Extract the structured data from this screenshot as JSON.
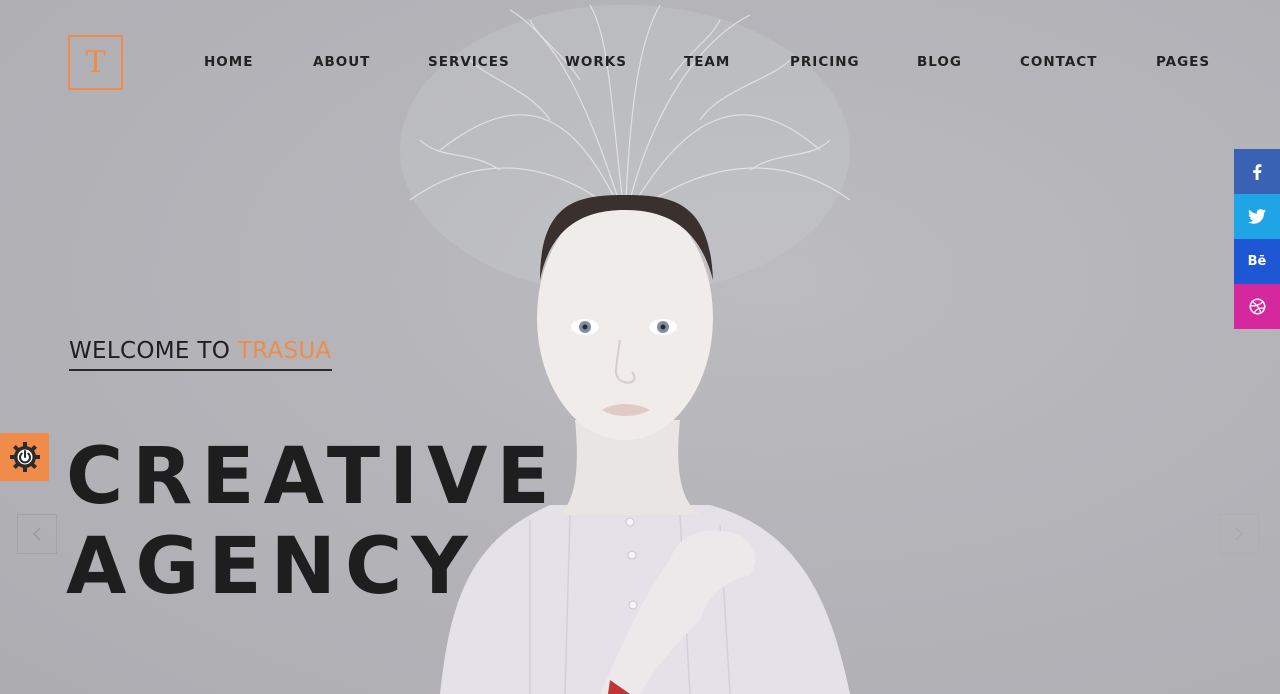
{
  "logo": {
    "letter": "T",
    "color": "#ef8c4a"
  },
  "nav": {
    "items": [
      {
        "label": "HOME"
      },
      {
        "label": "ABOUT"
      },
      {
        "label": "SERVICES"
      },
      {
        "label": "WORKS"
      },
      {
        "label": "TEAM"
      },
      {
        "label": "PRICING"
      },
      {
        "label": "BLOG"
      },
      {
        "label": "CONTACT"
      },
      {
        "label": "PAGES"
      }
    ]
  },
  "hero": {
    "welcome_prefix": "WELCOME TO",
    "welcome_brand": "TRASUA",
    "headline_line1": "CREATIVE",
    "headline_line2": "AGENCY"
  },
  "settings": {
    "icon": "gear-power-icon"
  },
  "slider": {
    "prev_icon": "chevron-left-icon",
    "next_icon": "chevron-right-icon"
  },
  "social": {
    "items": [
      {
        "name": "facebook",
        "icon": "facebook-icon",
        "color": "#3a62b4"
      },
      {
        "name": "twitter",
        "icon": "twitter-icon",
        "color": "#1fa5e6"
      },
      {
        "name": "behance",
        "icon": "behance-icon",
        "label": "Bē",
        "color": "#1d57d4"
      },
      {
        "name": "dribbble",
        "icon": "dribbble-icon",
        "color": "#d6289e"
      }
    ]
  },
  "colors": {
    "accent": "#ef8c4a",
    "text": "#1f1f1f",
    "background": "#b4b4b9"
  }
}
